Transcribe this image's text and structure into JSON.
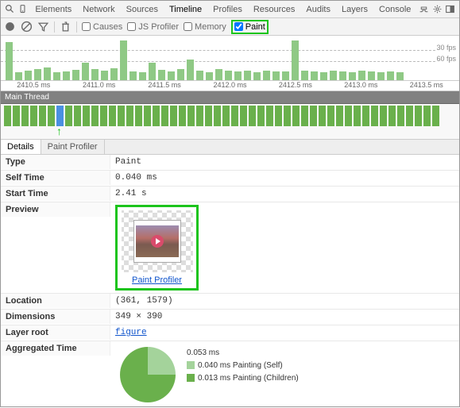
{
  "mainTabs": [
    "Elements",
    "Network",
    "Sources",
    "Timeline",
    "Profiles",
    "Resources",
    "Audits",
    "Layers",
    "Console"
  ],
  "mainTabsActive": "Timeline",
  "toolbar": {
    "causes": "Causes",
    "jsprofiler": "JS Profiler",
    "memory": "Memory",
    "paint": "Paint"
  },
  "overview": {
    "fps30": "30 fps",
    "fps60": "60 fps",
    "ticks": [
      "2410.5 ms",
      "2411.0 ms",
      "2411.5 ms",
      "2412.0 ms",
      "2412.5 ms",
      "2413.0 ms",
      "2413.5 ms"
    ]
  },
  "mainThreadLabel": "Main Thread",
  "subtabs": {
    "details": "Details",
    "profiler": "Paint Profiler"
  },
  "details": {
    "typeK": "Type",
    "typeV": "Paint",
    "selfK": "Self Time",
    "selfV": "0.040 ms",
    "startK": "Start Time",
    "startV": "2.41 s",
    "previewK": "Preview",
    "previewLink": "Paint Profiler",
    "locationK": "Location",
    "locationV": "(361, 1579)",
    "dimK": "Dimensions",
    "dimV": "349 × 390",
    "layerK": "Layer root",
    "layerV": "figure",
    "aggK": "Aggregated Time",
    "aggTotal": "0.053 ms",
    "aggSelf": "0.040 ms Painting (Self)",
    "aggChildren": "0.013 ms Painting (Children)"
  },
  "chart_data": {
    "type": "pie",
    "series": [
      {
        "name": "Painting (Self)",
        "value": 0.04
      },
      {
        "name": "Painting (Children)",
        "value": 0.013
      }
    ],
    "total": 0.053,
    "unit": "ms"
  }
}
